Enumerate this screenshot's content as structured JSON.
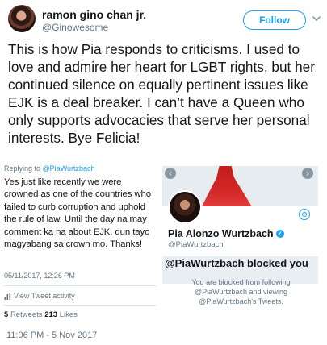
{
  "header": {
    "display_name": "ramon gino chan jr.",
    "handle": "@Ginowesome",
    "follow_label": "Follow"
  },
  "tweet": {
    "text": "This is how Pia responds to criticisms. I used to love and admire her heart for LGBT rights, but her continued silence on equally pertinent issues like EJK is a deal breaker. I can’t have a Queen who only supports advocacies that serve her personal interests. Bye Felicia!",
    "timestamp": "11:06 PM - 5 Nov 2017"
  },
  "left_screenshot": {
    "reply_prefix": "Replying to ",
    "reply_handle": "@PiaWurtzbach",
    "body": "Yes just like recently we were crowned as one of the countries who failed to curb corruption and uphold the rule of law. Until the day na may comment ka na about EJK, dun tayo magyabang sa crown mo. Thanks!",
    "date": "05/11/2017, 12:26 PM",
    "activity_label": "View Tweet activity",
    "retweets_count": "5",
    "retweets_label": "Retweets",
    "likes_count": "213",
    "likes_label": "Likes"
  },
  "right_screenshot": {
    "profile_name": "Pia Alonzo Wurtzbach",
    "profile_handle": "@PiaWurtzbach",
    "blocked_title": "@PiaWurtzbach blocked you",
    "blocked_text": "You are blocked from following @PiaWurtzbach and viewing @PiaWurtzbach's Tweets.",
    "nav_left": "‹",
    "nav_right": "›",
    "verified_mark": "✓"
  },
  "colors": {
    "accent": "#1da1f2",
    "secondary_text": "#657786",
    "banner_dress": "#c01e1e"
  },
  "icons": [
    "avatar",
    "chevron-down-icon",
    "bar-chart-icon",
    "verified-badge-icon",
    "gear-icon",
    "nav-arrow-left-icon",
    "nav-arrow-right-icon"
  ]
}
